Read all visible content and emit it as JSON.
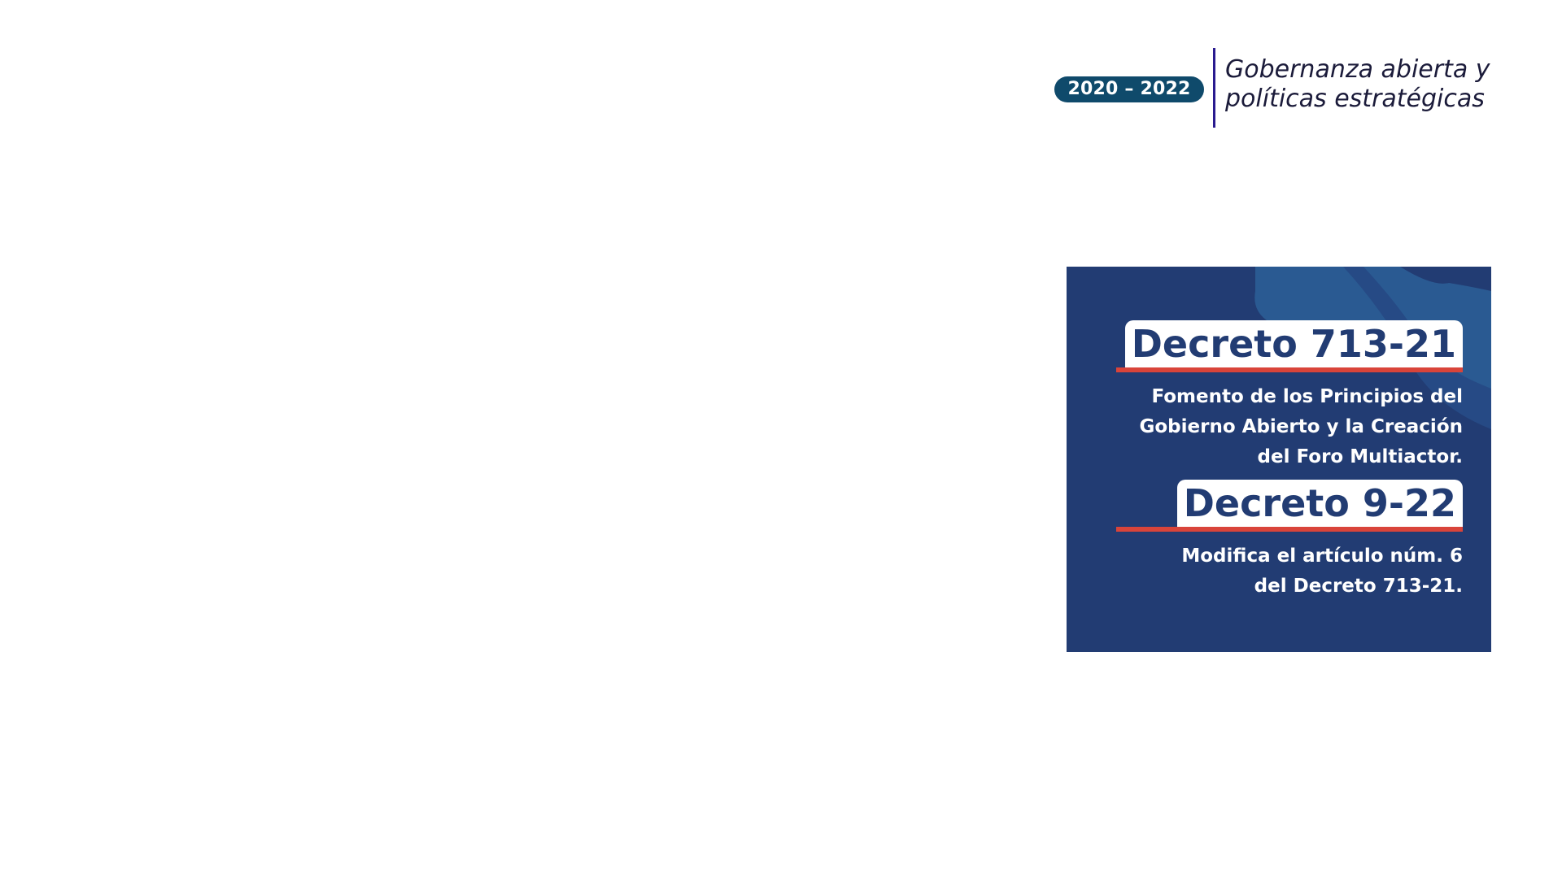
{
  "header": {
    "year_range": "2020 – 2022",
    "title_line1": "Gobernanza abierta y",
    "title_line2": "políticas estratégicas"
  },
  "card": {
    "decrees": [
      {
        "label": "Decreto 713-21",
        "description_lines": [
          "Fomento de los Principios del",
          "Gobierno Abierto y la Creación",
          "del Foro Multiactor."
        ]
      },
      {
        "label": "Decreto 9-22",
        "description_lines": [
          "Modifica el artículo núm. 6",
          "del Decreto 713-21."
        ]
      }
    ]
  },
  "colors": {
    "badge": "#0f4a6b",
    "divider": "#2a1a8f",
    "card_background": "#223c73",
    "card_decor": "#2a5a92",
    "accent_rule": "#d9443a"
  }
}
